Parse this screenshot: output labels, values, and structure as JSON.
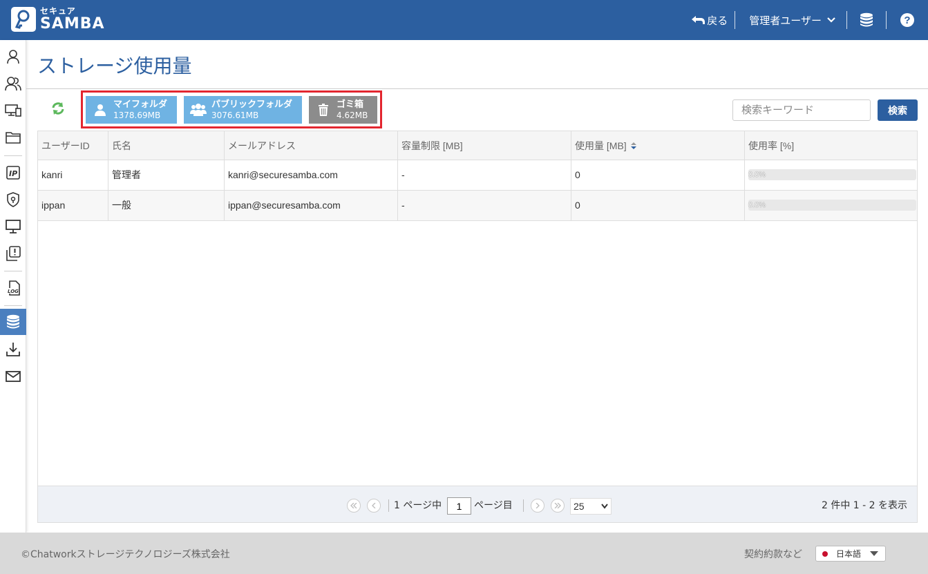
{
  "header": {
    "logo_sub": "セキュア",
    "logo_main": "SAMBA",
    "back_label": "戻る",
    "user_label": "管理者ユーザー",
    "help_label": "?"
  },
  "sidebar": {
    "items": [
      {
        "name": "user-icon"
      },
      {
        "name": "users-icon"
      },
      {
        "name": "devices-icon"
      },
      {
        "name": "folder-icon"
      },
      {
        "name": "ip-icon"
      },
      {
        "name": "security-shield-icon"
      },
      {
        "name": "monitor-icon"
      },
      {
        "name": "alert-copy-icon"
      },
      {
        "name": "log-icon"
      },
      {
        "name": "storage-database-icon",
        "active": true
      },
      {
        "name": "download-icon"
      },
      {
        "name": "mail-icon"
      }
    ]
  },
  "page": {
    "title": "ストレージ使用量"
  },
  "toolbar": {
    "folders": [
      {
        "name": "マイフォルダ",
        "size": "1378.69MB"
      },
      {
        "name": "パブリックフォルダ",
        "size": "3076.61MB"
      },
      {
        "name": "ゴミ箱",
        "size": "4.62MB"
      }
    ],
    "search_placeholder": "検索キーワード",
    "search_label": "検索"
  },
  "table": {
    "columns": [
      "ユーザーID",
      "氏名",
      "メールアドレス",
      "容量制限 [MB]",
      "使用量 [MB]",
      "使用率 [%]"
    ],
    "rows": [
      {
        "id": "kanri",
        "name": "管理者",
        "email": "kanri@securesamba.com",
        "limit": "-",
        "usage": "0",
        "rate": "0.0%",
        "rate_value": 0
      },
      {
        "id": "ippan",
        "name": "一般",
        "email": "ippan@securesamba.com",
        "limit": "-",
        "usage": "0",
        "rate": "0.0%",
        "rate_value": 0
      }
    ]
  },
  "pager": {
    "page_prefix": "1 ページ中",
    "current_page": "1",
    "page_suffix": "ページ目",
    "page_size": "25",
    "info": "2 件中 1 - 2 を表示"
  },
  "footer": {
    "copyright": "©Chatworkストレージテクノロジーズ株式会社",
    "terms": "契約約款など",
    "language": "日本語"
  },
  "colors": {
    "header_bg": "#2c5fa0",
    "folder_blue": "#6fb3e3",
    "trash_gray": "#8c8c8c",
    "highlight_red": "#e3262f",
    "refresh_green": "#5cb85c"
  }
}
